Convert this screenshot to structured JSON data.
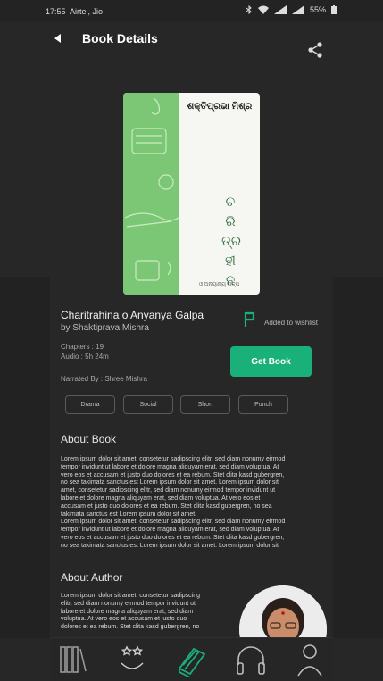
{
  "status_bar": {
    "time": "17:55",
    "carrier": "Airtel, Jio",
    "battery": "55%"
  },
  "header": {
    "title": "Book Details"
  },
  "cover": {
    "author_text": "ଶକ୍ତିପ୍ରଭା ମିଶ୍ର",
    "title_chars": [
      "ଚ",
      "ରି",
      "ତ୍ର",
      "ହୀ",
      "ନ"
    ],
    "bottom_text": "ଓ ଅନ୍ୟାନ୍ୟ ଗଳ୍ପ"
  },
  "book": {
    "title": "Charitrahina o Anyanya Galpa",
    "author": "by Shaktiprava Mishra",
    "chapters": "Chapters : 19",
    "audio": "Audio : 5h 24m",
    "narrated_by": "Narrated By  : Shree Mishra"
  },
  "wishlist": {
    "label": "Added to wishlist"
  },
  "get_book_label": "Get Book",
  "tags": [
    "Drama",
    "Social",
    "Short",
    "Punch"
  ],
  "about_book": {
    "heading": "About Book",
    "lines": [
      "Lorem ipsum dolor sit amet, consetetur sadipscing elitr, sed diam nonumy eirmod",
      "tempor invidunt ut labore et dolore magna aliquyam erat, sed diam voluptua. At",
      "vero eos et accusam et justo duo dolores et ea rebum. Stet clita kasd gubergren,",
      "no sea takimata sanctus est Lorem ipsum dolor sit amet. Lorem ipsum dolor sit",
      "amet, consetetur sadipscing elitr, sed diam nonumy eirmod tempor invidunt ut",
      "labore et dolore magna aliquyam erat, sed diam voluptua. At vero eos et",
      "accusam et justo duo dolores et ea rebum. Stet clita kasd gubergren, no sea",
      "takimata sanctus est Lorem ipsum dolor sit amet.",
      "Lorem ipsum dolor sit amet, consetetur sadipscing elitr, sed diam nonumy eirmod",
      "tempor invidunt ut labore et dolore magna aliquyam erat, sed diam voluptua. At",
      "vero eos et accusam et justo duo dolores et ea rebum. Stet clita kasd gubergren,",
      "no sea takimata sanctus est Lorem ipsum dolor sit amet. Lorem ipsum dolor sit"
    ]
  },
  "about_author": {
    "heading": "About Author",
    "lines": [
      "Lorem ipsum dolor sit amet, consetetur sadipscing",
      "elitr, sed diam nonumy eirmod tempor invidunt ut",
      "labore et dolore magna aliquyam erat, sed diam",
      "voluptua. At vero eos et accusam et justo duo",
      "dolores et ea rebum. Stet clita kasd gubergren, no"
    ]
  },
  "bottom_nav": [
    {
      "icon": "library-books-icon"
    },
    {
      "icon": "stars-smile-icon"
    },
    {
      "icon": "book-stack-icon",
      "active": true
    },
    {
      "icon": "headphones-icon"
    },
    {
      "icon": "profile-icon"
    }
  ],
  "colors": {
    "accent": "#19b07a",
    "background": "#272727",
    "cover_green": "#7cc775"
  }
}
